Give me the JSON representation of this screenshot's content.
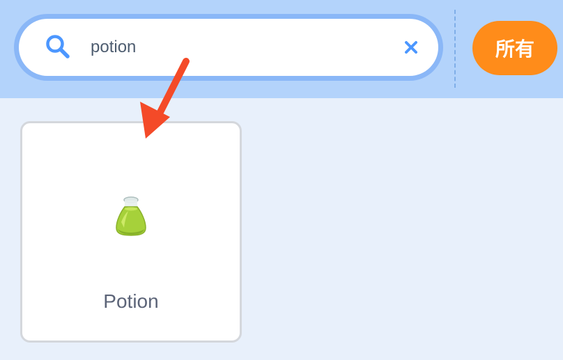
{
  "search": {
    "value": "potion",
    "placeholder": ""
  },
  "filter": {
    "label": "所有"
  },
  "results": [
    {
      "label": "Potion"
    }
  ],
  "colors": {
    "topbar": "#b3d3fb",
    "search_ring": "#8ab7f7",
    "background": "#e8f0fb",
    "accent": "#ff8c1a",
    "icon_blue": "#4c97ff",
    "arrow": "#f44a28"
  },
  "icons": {
    "search": "magnifier-icon",
    "clear": "x-icon",
    "thumbnail": "potion-bottle-icon",
    "annotation": "red-arrow-icon"
  }
}
